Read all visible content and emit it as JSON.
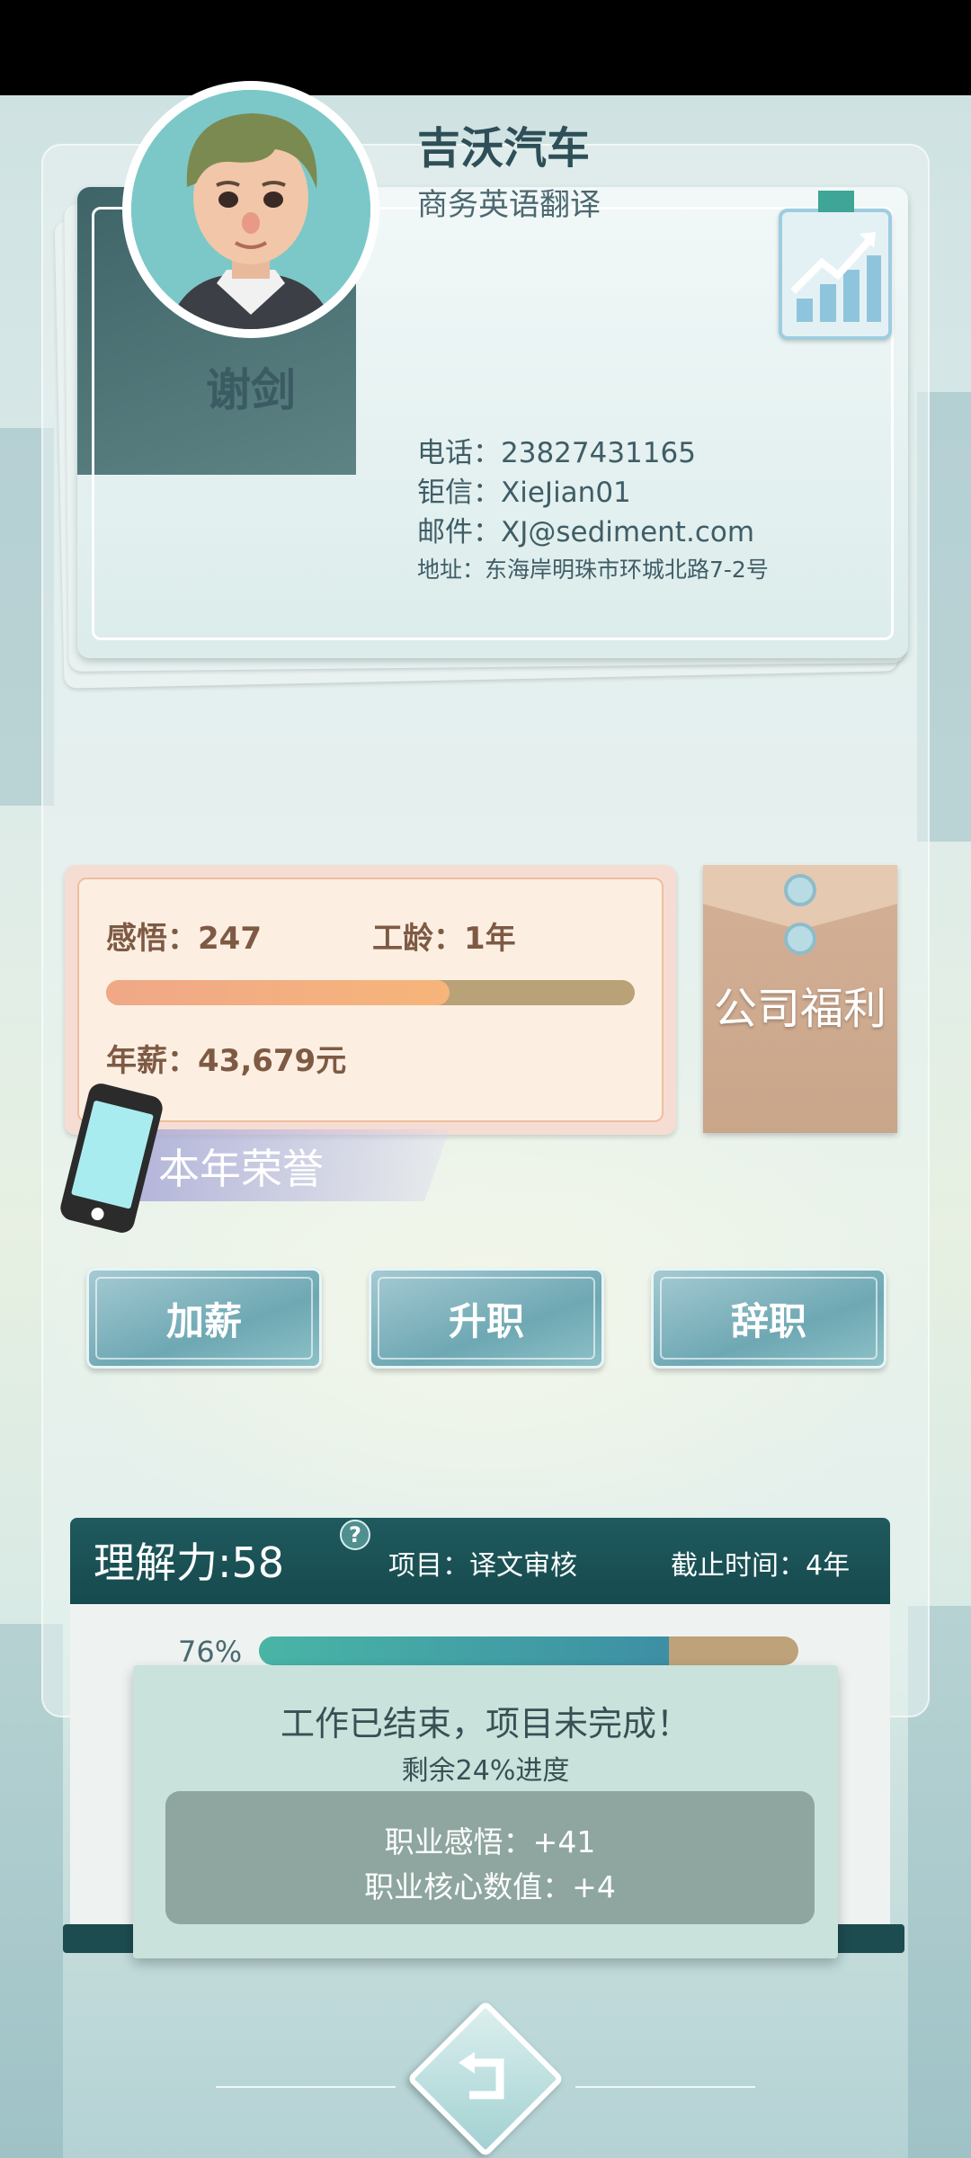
{
  "profile": {
    "name": "谢剑",
    "company": "吉沃汽车",
    "job_title": "商务英语翻译",
    "phone": "电话：23827431165",
    "chat": "钜信：XieJian01",
    "email": "邮件：XJ@sediment.com",
    "address": "地址：东海岸明珠市环城北路7-2号"
  },
  "stats": {
    "insight": "感悟：247",
    "seniority": "工龄：1年",
    "salary": "年薪：43,679元",
    "progress_fraction": 0.65
  },
  "welfare_label": "公司福利",
  "honor_label": "本年荣誉",
  "actions": {
    "raise": "加薪",
    "promote": "升职",
    "resign": "辞职"
  },
  "work": {
    "ability": "理解力:58",
    "help": "?",
    "project": "项目：译文审核",
    "deadline": "截止时间：4年",
    "percent_text": "76%",
    "percent_value": 0.76
  },
  "result": {
    "title": "工作已结束，项目未完成！",
    "remaining": "剩余24%进度",
    "reward_insight": "职业感悟：+41",
    "reward_core": "职业核心数值：+4"
  },
  "icons": {
    "back": "back-arrow-icon",
    "chart": "growth-chart-icon",
    "phone": "phone-icon"
  }
}
